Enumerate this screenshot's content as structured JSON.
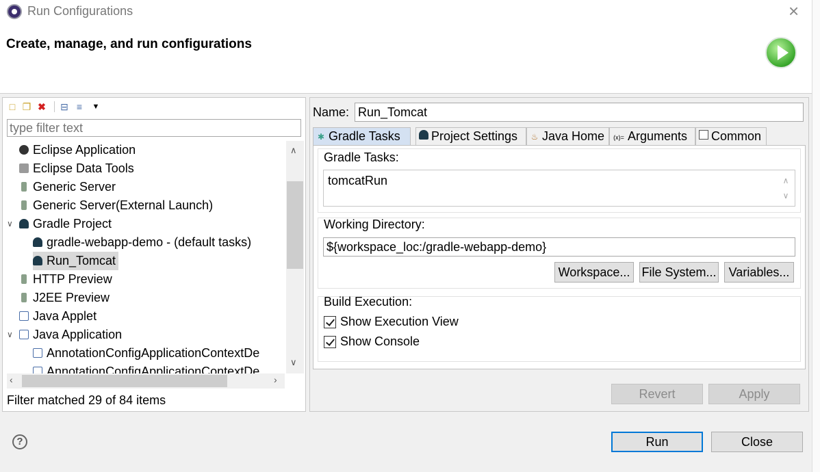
{
  "window": {
    "title": "Run Configurations",
    "close_glyph": "×"
  },
  "header": {
    "title": "Create, manage, and run configurations",
    "badge_icon": "run-icon"
  },
  "left": {
    "toolbar_icons": [
      "new-config-icon",
      "duplicate-icon",
      "delete-icon",
      "collapse-all-icon",
      "filter-icon",
      "view-menu-icon"
    ],
    "filter_placeholder": "type filter text",
    "tree": [
      {
        "label": "Eclipse Application",
        "icon": "eclipse-icon",
        "level": 0
      },
      {
        "label": "Eclipse Data Tools",
        "icon": "database-icon",
        "level": 0
      },
      {
        "label": "Generic Server",
        "icon": "server-icon",
        "level": 0
      },
      {
        "label": "Generic Server(External Launch)",
        "icon": "server-icon",
        "level": 0
      },
      {
        "label": "Gradle Project",
        "icon": "gradle-icon",
        "level": 0,
        "expanded": true
      },
      {
        "label": "gradle-webapp-demo - (default tasks)",
        "icon": "gradle-icon",
        "level": 1
      },
      {
        "label": "Run_Tomcat",
        "icon": "gradle-icon",
        "level": 1,
        "selected": true
      },
      {
        "label": "HTTP Preview",
        "icon": "server-icon",
        "level": 0
      },
      {
        "label": "J2EE Preview",
        "icon": "server-icon",
        "level": 0
      },
      {
        "label": "Java Applet",
        "icon": "applet-icon",
        "level": 0
      },
      {
        "label": "Java Application",
        "icon": "java-app-icon",
        "level": 0,
        "expanded": true
      },
      {
        "label": "AnnotationConfigApplicationContextDe",
        "icon": "java-class-icon",
        "level": 1
      },
      {
        "label": "AnnotationConfigApplicationContextDe",
        "icon": "java-class-icon",
        "level": 1
      }
    ],
    "status": "Filter matched 29 of 84 items"
  },
  "right": {
    "name_label": "Name:",
    "name_value": "Run_Tomcat",
    "tabs": [
      {
        "label": "Gradle Tasks",
        "icon": "gradle-tasks-icon",
        "active": true
      },
      {
        "label": "Project Settings",
        "icon": "gradle-icon",
        "active": false
      },
      {
        "label": "Java Home",
        "icon": "java-home-icon",
        "active": false
      },
      {
        "label": "Arguments",
        "icon": "arguments-icon",
        "active": false
      },
      {
        "label": "Common",
        "icon": "common-icon",
        "active": false
      }
    ],
    "gradle_tasks_label": "Gradle Tasks:",
    "gradle_tasks_value": "tomcatRun",
    "working_dir_label": "Working Directory:",
    "working_dir_value": "${workspace_loc:/gradle-webapp-demo}",
    "buttons": {
      "workspace": "Workspace...",
      "filesystem": "File System...",
      "variables": "Variables..."
    },
    "build_execution_label": "Build Execution:",
    "show_execution_view": {
      "label": "Show Execution View",
      "checked": true
    },
    "show_console": {
      "label": "Show Console",
      "checked": true
    },
    "revert": "Revert",
    "apply": "Apply"
  },
  "footer": {
    "help_glyph": "?",
    "run": "Run",
    "close": "Close"
  }
}
